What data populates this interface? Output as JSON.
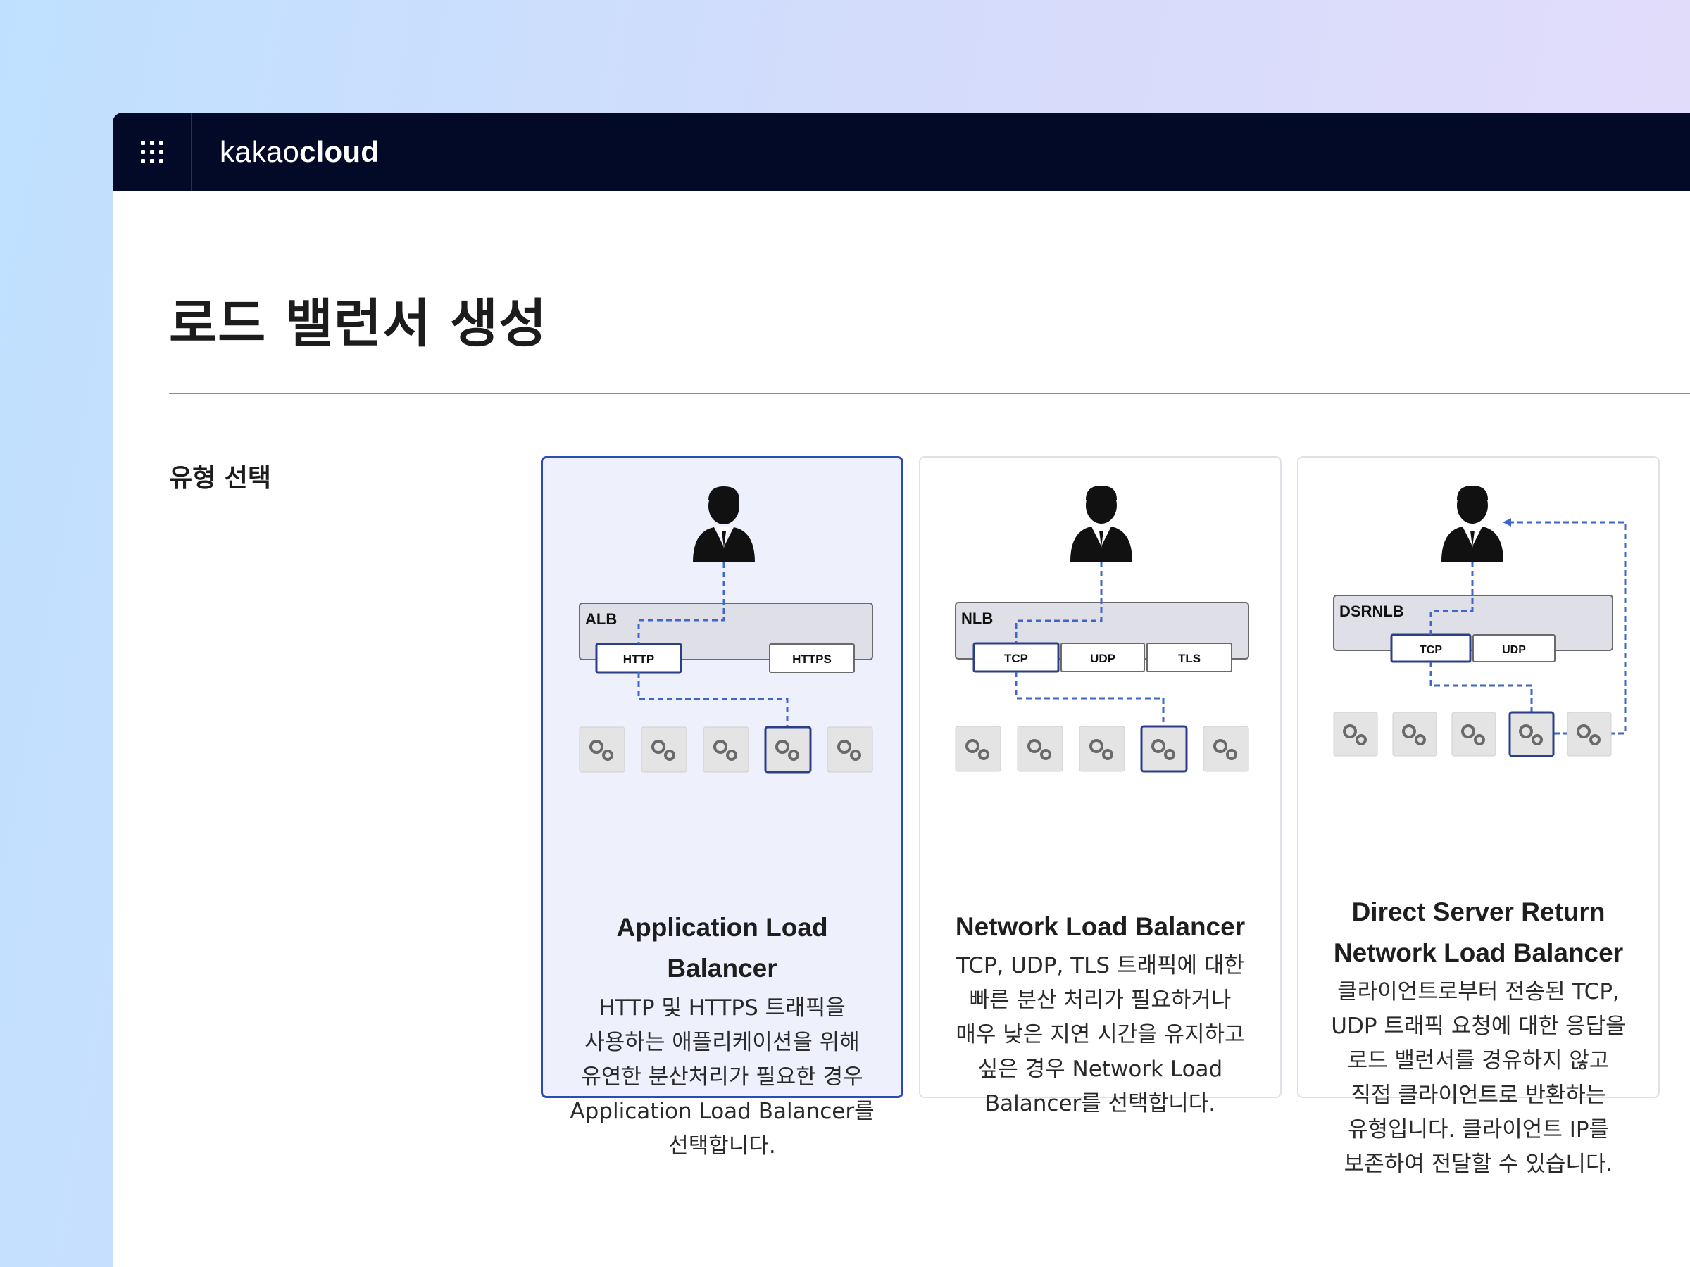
{
  "header": {
    "brand_light": "kakao",
    "brand_bold": "cloud"
  },
  "page": {
    "title": "로드 밸런서 생성",
    "section_label": "유형 선택"
  },
  "cards": [
    {
      "badge": "ALB",
      "protocols": [
        "HTTP",
        "HTTPS"
      ],
      "title": "Application Load\nBalancer",
      "description": "HTTP 및 HTTPS 트래픽을\n사용하는 애플리케이션을 위해\n유연한 분산처리가 필요한 경우\nApplication Load Balancer를\n선택합니다.",
      "selected": true
    },
    {
      "badge": "NLB",
      "protocols": [
        "TCP",
        "UDP",
        "TLS"
      ],
      "title": "Network Load Balancer",
      "description": "TCP, UDP, TLS 트래픽에 대한\n빠른 분산 처리가 필요하거나\n매우 낮은 지연 시간을 유지하고\n싶은 경우 Network Load\nBalancer를 선택합니다.",
      "selected": false
    },
    {
      "badge": "DSRNLB",
      "protocols": [
        "TCP",
        "UDP"
      ],
      "title": "Direct Server Return\nNetwork Load Balancer",
      "description": "클라이언트로부터 전송된 TCP,\nUDP 트래픽 요청에 대한 응답을\n로드 밸런서를 경유하지 않고\n직접 클라이언트로 반환하는\n유형입니다. 클라이언트 IP를\n보존하여 전달할 수 있습니다.",
      "selected": false
    }
  ],
  "colors": {
    "selected_border": "#2b4bb8",
    "flow_line": "#3e67c9",
    "topbar": "#020a27"
  }
}
